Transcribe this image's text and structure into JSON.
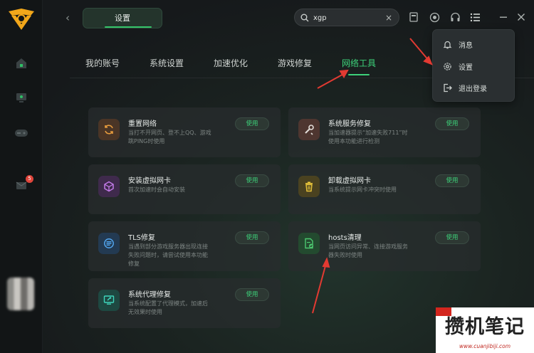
{
  "header": {
    "page_tab": "设置",
    "search_value": "xgp"
  },
  "nav_tabs": [
    "我的账号",
    "系统设置",
    "加速优化",
    "游戏修复",
    "网络工具"
  ],
  "active_tab": "网络工具",
  "sidebar": {
    "notification_badge": "5"
  },
  "menu": {
    "items": [
      {
        "label": "消息",
        "icon": "bell-icon"
      },
      {
        "label": "设置",
        "icon": "gear-icon"
      },
      {
        "label": "退出登录",
        "icon": "logout-icon"
      }
    ]
  },
  "cards": [
    {
      "title": "重置网络",
      "desc": "当打不开网页、登不上QQ、游戏跳PING时使用",
      "button": "使用",
      "icon": "refresh-icon",
      "color": "#c77c2a"
    },
    {
      "title": "系统服务修复",
      "desc": "当加速器提示“加速失败711”时使用本功能进行检测",
      "button": "使用",
      "icon": "wrench-icon",
      "color": "#b86a58"
    },
    {
      "title": "安装虚拟网卡",
      "desc": "首次加速时会自动安装",
      "button": "使用",
      "icon": "cube-icon",
      "color": "#a356c8"
    },
    {
      "title": "卸载虚拟网卡",
      "desc": "当系统提示网卡冲突时使用",
      "button": "使用",
      "icon": "trash-icon",
      "color": "#d7b32d"
    },
    {
      "title": "TLS修复",
      "desc": "当遇到部分游戏服务器出现连接失败问题时，请尝试使用本功能修复",
      "button": "使用",
      "icon": "tls-icon",
      "color": "#3e8fd6"
    },
    {
      "title": "hosts清理",
      "desc": "当网页访问异常、连接游戏服务器失败时使用",
      "button": "使用",
      "icon": "file-check-icon",
      "color": "#3fb25c"
    },
    {
      "title": "系统代理修复",
      "desc": "当系统配置了代理模式，加速后无效果时使用",
      "button": "使用",
      "icon": "monitor-repair-icon",
      "color": "#2fb7a2"
    }
  ],
  "watermark": {
    "logo_text": "攒机笔记",
    "url": "www.cuanjibiji.com"
  }
}
